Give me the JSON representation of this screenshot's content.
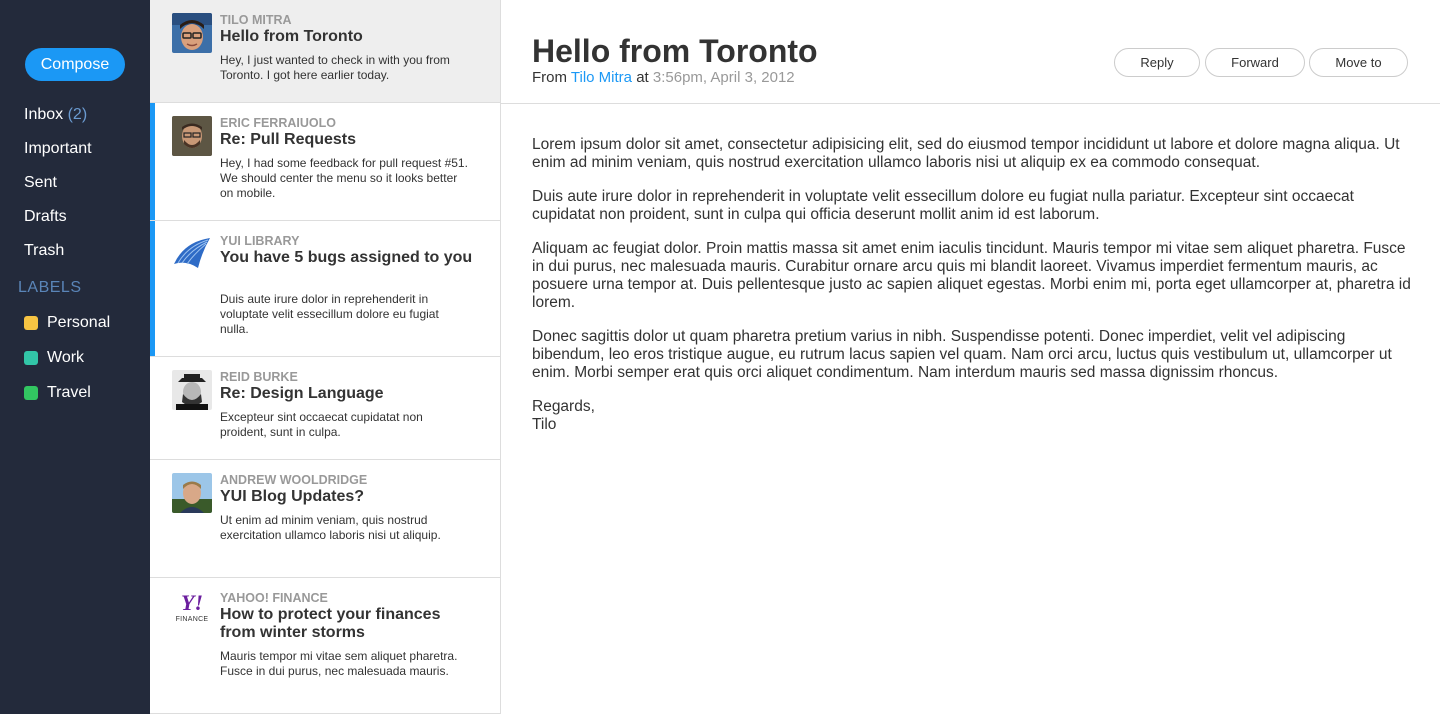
{
  "sidebar": {
    "compose_label": "Compose",
    "nav": [
      {
        "label": "Inbox",
        "count": "(2)"
      },
      {
        "label": "Important",
        "count": ""
      },
      {
        "label": "Sent",
        "count": ""
      },
      {
        "label": "Drafts",
        "count": ""
      },
      {
        "label": "Trash",
        "count": ""
      }
    ],
    "labels_heading": "LABELS",
    "labels": [
      {
        "label": "Personal",
        "color": "#f7c443"
      },
      {
        "label": "Work",
        "color": "#32c6a8"
      },
      {
        "label": "Travel",
        "color": "#32c661"
      }
    ]
  },
  "messages": [
    {
      "sender": "Tilo Mitra",
      "subject": "Hello from Toronto",
      "preview": "Hey, I just wanted to check in with you from Toronto. I got here earlier today.",
      "avatar_icon": "person-avatar-icon"
    },
    {
      "sender": "Eric Ferraiuolo",
      "subject": "Re: Pull Requests",
      "preview": "Hey, I had some feedback for pull request #51. We should center the menu so it looks better on mobile.",
      "avatar_icon": "person-avatar-icon"
    },
    {
      "sender": "YUI Library",
      "subject": "You have 5 bugs assigned to you",
      "preview": "Duis aute irure dolor in reprehenderit in voluptate velit essecillum dolore eu fugiat nulla.",
      "avatar_icon": "yui-logo-icon"
    },
    {
      "sender": "Reid Burke",
      "subject": "Re: Design Language",
      "preview": "Excepteur sint occaecat cupidatat non proident, sunt in culpa.",
      "avatar_icon": "person-avatar-icon"
    },
    {
      "sender": "Andrew Wooldridge",
      "subject": "YUI Blog Updates?",
      "preview": "Ut enim ad minim veniam, quis nostrud exercitation ullamco laboris nisi ut aliquip.",
      "avatar_icon": "person-avatar-icon"
    },
    {
      "sender": "Yahoo! Finance",
      "subject": "How to protect your finances from winter storms",
      "preview": "Mauris tempor mi vitae sem aliquet pharetra. Fusce in dui purus, nec malesuada mauris.",
      "avatar_icon": "yahoo-finance-logo-icon",
      "logo_text": "Y!",
      "logo_sub": "FINANCE"
    }
  ],
  "email": {
    "title": "Hello from Toronto",
    "from_prefix": "From",
    "from_name": "Tilo Mitra",
    "at": "at",
    "date": "3:56pm, April 3, 2012",
    "actions": {
      "reply": "Reply",
      "forward": "Forward",
      "move": "Move to"
    },
    "paragraphs": [
      "Lorem ipsum dolor sit amet, consectetur adipisicing elit, sed do eiusmod tempor incididunt ut labore et dolore magna aliqua. Ut enim ad minim veniam, quis nostrud exercitation ullamco laboris nisi ut aliquip ex ea commodo consequat.",
      "Duis aute irure dolor in reprehenderit in voluptate velit essecillum dolore eu fugiat nulla pariatur. Excepteur sint occaecat cupidatat non proident, sunt in culpa qui officia deserunt mollit anim id est laborum.",
      "Aliquam ac feugiat dolor. Proin mattis massa sit amet enim iaculis tincidunt. Mauris tempor mi vitae sem aliquet pharetra. Fusce in dui purus, nec malesuada mauris. Curabitur ornare arcu quis mi blandit laoreet. Vivamus imperdiet fermentum mauris, ac posuere urna tempor at. Duis pellentesque justo ac sapien aliquet egestas. Morbi enim mi, porta eget ullamcorper at, pharetra id lorem.",
      "Donec sagittis dolor ut quam pharetra pretium varius in nibh. Suspendisse potenti. Donec imperdiet, velit vel adipiscing bibendum, leo eros tristique augue, eu rutrum lacus sapien vel quam. Nam orci arcu, luctus quis vestibulum ut, ullamcorper ut enim. Morbi semper erat quis orci aliquet condimentum. Nam interdum mauris sed massa dignissim rhoncus."
    ],
    "signoff": "Regards,",
    "signature": "Tilo"
  }
}
